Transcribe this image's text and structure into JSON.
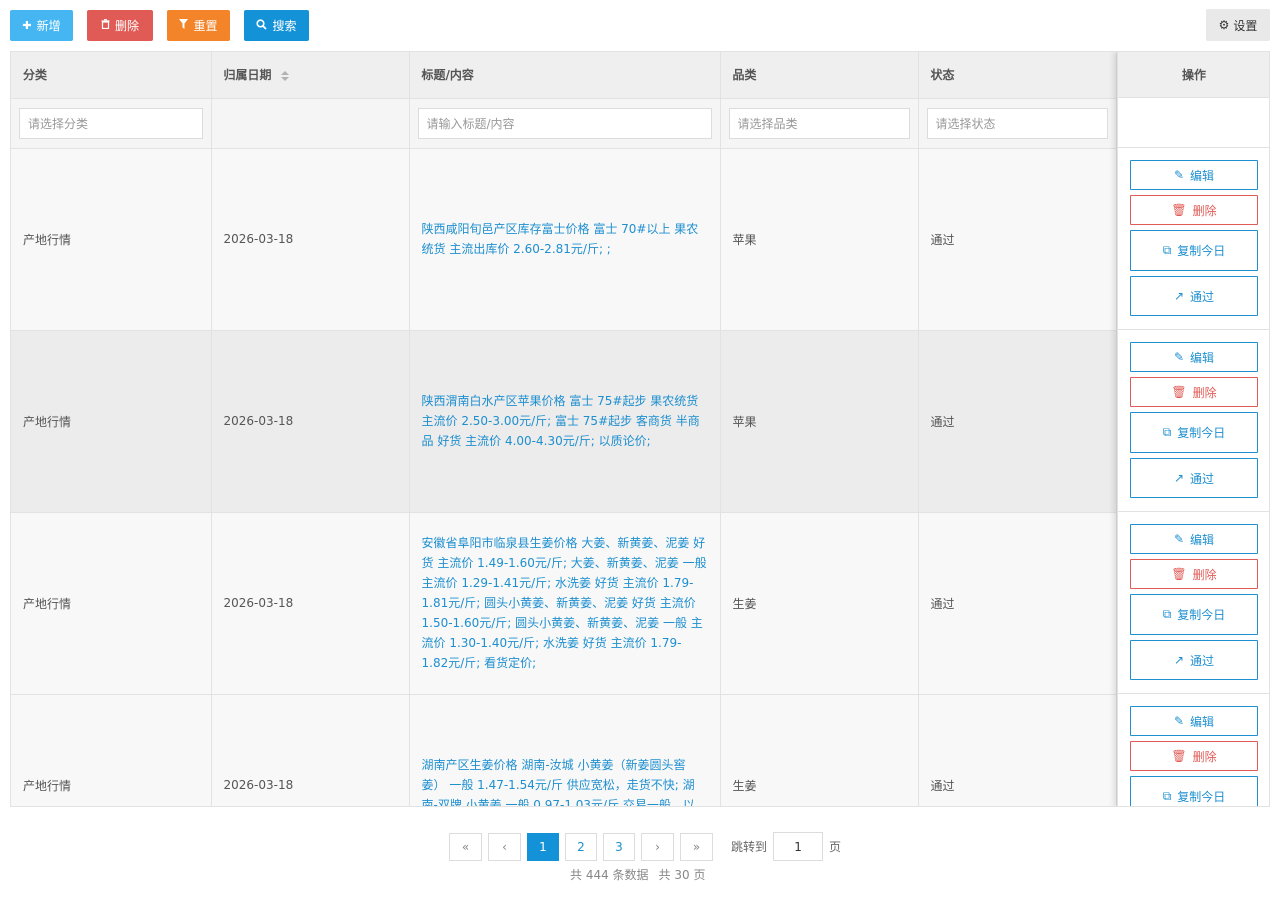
{
  "toolbar": {
    "add_label": "新增",
    "delete_label": "删除",
    "reset_label": "重置",
    "search_label": "搜索",
    "settings_label": "设置"
  },
  "table": {
    "columns": [
      "分类",
      "归属日期",
      "标题/内容",
      "品类",
      "状态",
      "操作"
    ],
    "filters": {
      "category_placeholder": "请选择分类",
      "title_placeholder": "请输入标题/内容",
      "variety_placeholder": "请选择品类",
      "status_placeholder": "请选择状态"
    },
    "rows": [
      {
        "category": "产地行情",
        "date": "2026-03-18",
        "title": "陕西咸阳旬邑产区库存富士价格 富士 70#以上 果农统货 主流出库价 2.60-2.81元/斤; ;",
        "variety": "苹果",
        "status": "通过"
      },
      {
        "category": "产地行情",
        "date": "2026-03-18",
        "title": "陕西渭南白水产区苹果价格 富士 75#起步 果农统货 主流价 2.50-3.00元/斤; 富士 75#起步 客商货 半商品 好货 主流价 4.00-4.30元/斤; 以质论价;",
        "variety": "苹果",
        "status": "通过"
      },
      {
        "category": "产地行情",
        "date": "2026-03-18",
        "title": "安徽省阜阳市临泉县生姜价格 大姜、新黄姜、泥姜 好货 主流价 1.49-1.60元/斤; 大姜、新黄姜、泥姜 一般 主流价 1.29-1.41元/斤; 水洗姜 好货 主流价 1.79-1.81元/斤; 圆头小黄姜、新黄姜、泥姜 好货 主流价 1.50-1.60元/斤; 圆头小黄姜、新黄姜、泥姜 一般 主流价 1.30-1.40元/斤; 水洗姜 好货 主流价 1.79-1.82元/斤; 看货定价;",
        "variety": "生姜",
        "status": "通过"
      },
      {
        "category": "产地行情",
        "date": "2026-03-18",
        "title": "湖南产区生姜价格 湖南-汝城 小黄姜（新姜圆头窖姜） 一般 1.47-1.54元/斤 供应宽松，走货不快; 湖南-双牌 小黄姜 一般 0.97-1.03元/斤 交易一般，以",
        "variety": "生姜",
        "status": "通过"
      }
    ],
    "actions": {
      "edit": "编辑",
      "delete": "删除",
      "copy_today": "复制今日",
      "pass": "通过"
    }
  },
  "pagination": {
    "first": "«",
    "prev": "‹",
    "pages": [
      "1",
      "2",
      "3"
    ],
    "next": "›",
    "last": "»",
    "jump_label": "跳转到",
    "jump_value": "1",
    "page_unit": "页",
    "total_records": "共 444 条数据",
    "total_pages": "共 30 页"
  },
  "colors": {
    "add": "#45b6f2",
    "delete": "#e15b56",
    "reset": "#f3842a",
    "search": "#1492d8",
    "link": "#1e8fcf"
  }
}
